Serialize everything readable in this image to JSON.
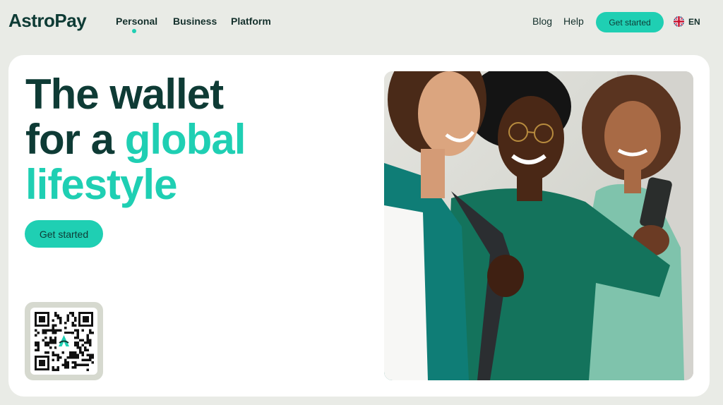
{
  "brand": {
    "logo_text": "AstroPay"
  },
  "nav": {
    "items": [
      {
        "label": "Personal",
        "active": true
      },
      {
        "label": "Business",
        "active": false
      },
      {
        "label": "Platform",
        "active": false
      }
    ],
    "blog": "Blog",
    "help": "Help",
    "cta": "Get started",
    "language": "EN",
    "language_icon": "uk-flag-icon"
  },
  "hero": {
    "headline_line1": "The wallet",
    "headline_line2_a": "for a ",
    "headline_line2_b": "global",
    "headline_line3": "lifestyle",
    "cta": "Get started",
    "qr_icon": "qr-code-icon",
    "photo_icon": "three-people-with-phone-photo"
  },
  "colors": {
    "accent": "#1fcfb3",
    "brand_dark": "#0e3b35",
    "page_background": "#e9ebe6",
    "card_background": "#ffffff"
  }
}
